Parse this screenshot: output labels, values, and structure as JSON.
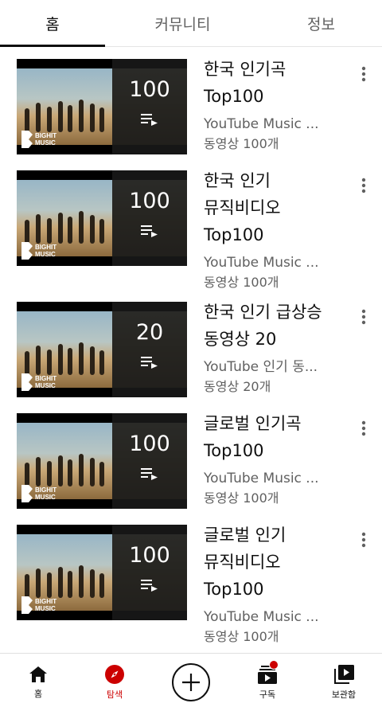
{
  "tabs": [
    {
      "label": "홈",
      "active": true
    },
    {
      "label": "커뮤니티",
      "active": false
    },
    {
      "label": "정보",
      "active": false
    }
  ],
  "playlists": [
    {
      "title_lines": [
        "한국 인기곡",
        "Top100"
      ],
      "channel": "YouTube Music ...",
      "meta": "동영상 100개",
      "count": "100",
      "logo_text": [
        "BIGHIT",
        "MUSIC"
      ]
    },
    {
      "title_lines": [
        "한국 인기",
        "뮤직비디오",
        "Top100"
      ],
      "channel": "YouTube Music ...",
      "meta": "동영상 100개",
      "count": "100",
      "logo_text": [
        "BIGHIT",
        "MUSIC"
      ]
    },
    {
      "title_lines": [
        "한국 인기 급상승",
        "동영상 20"
      ],
      "channel": "YouTube 인기 동...",
      "meta": "동영상 20개",
      "count": "20",
      "logo_text": [
        "BIGHIT",
        "MUSIC"
      ]
    },
    {
      "title_lines": [
        "글로벌 인기곡",
        "Top100"
      ],
      "channel": "YouTube Music ...",
      "meta": "동영상 100개",
      "count": "100",
      "logo_text": [
        "BIGHIT",
        "MUSIC"
      ]
    },
    {
      "title_lines": [
        "글로벌 인기",
        "뮤직비디오",
        "Top100"
      ],
      "channel": "YouTube Music ...",
      "meta": "동영상 100개",
      "count": "100",
      "logo_text": [
        "BIGHIT",
        "MUSIC"
      ]
    }
  ],
  "bottom_nav": [
    {
      "label": "홈",
      "icon": "home-icon",
      "active": false
    },
    {
      "label": "탐색",
      "icon": "compass-icon",
      "active": true
    },
    {
      "label": "",
      "icon": "create-icon",
      "active": false
    },
    {
      "label": "구독",
      "icon": "subscriptions-icon",
      "active": false,
      "badge": true
    },
    {
      "label": "보관함",
      "icon": "library-icon",
      "active": false
    }
  ],
  "colors": {
    "accent": "#cc0000",
    "text": "#0f0f0f",
    "secondary": "#606060"
  }
}
